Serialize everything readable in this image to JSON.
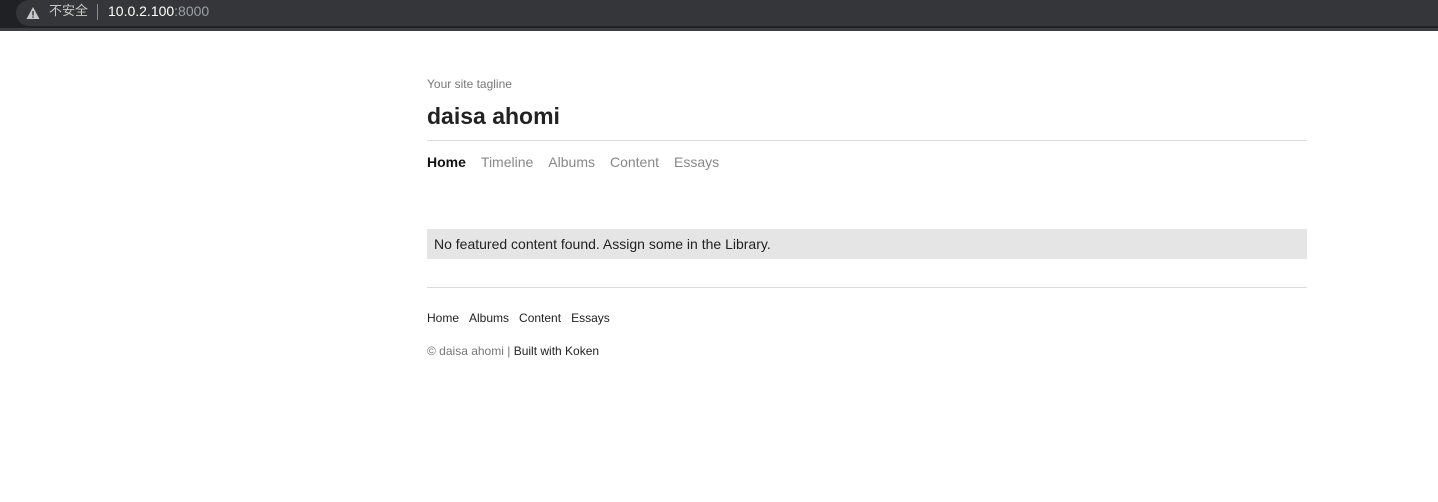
{
  "browser": {
    "insecure_label": "不安全",
    "url_host": "10.0.2.100",
    "url_port": ":8000"
  },
  "site": {
    "tagline": "Your site tagline",
    "title": "daisa ahomi",
    "nav": [
      {
        "label": "Home",
        "active": true
      },
      {
        "label": "Timeline"
      },
      {
        "label": "Albums"
      },
      {
        "label": "Content"
      },
      {
        "label": "Essays"
      }
    ],
    "notice": "No featured content found. Assign some in the Library.",
    "footer_nav": [
      "Home",
      "Albums",
      "Content",
      "Essays"
    ],
    "copyright_text": "© daisa ahomi |",
    "built_with": "Built with Koken"
  },
  "icons": {
    "warning": "warning-triangle-icon"
  },
  "colors": {
    "browser_bar": "#202124",
    "notice_bg": "#e5e5e5",
    "active_nav": "#111111",
    "inactive_nav": "#888888"
  }
}
